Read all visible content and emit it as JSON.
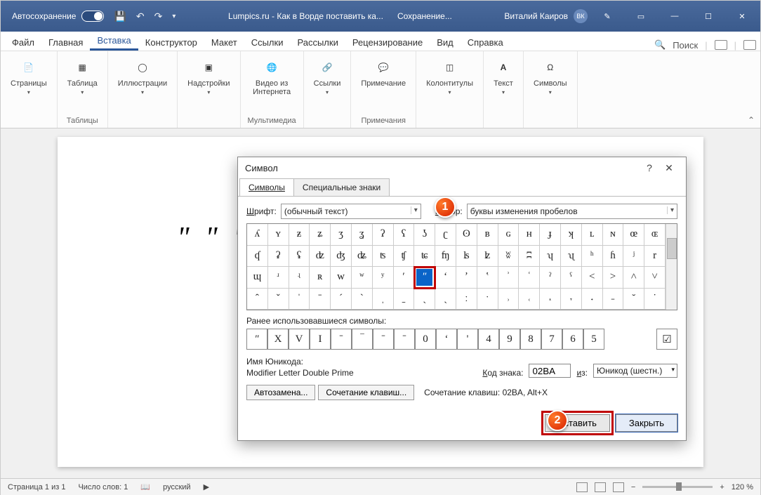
{
  "titlebar": {
    "autosave": "Автосохранение",
    "doc_title": "Lumpics.ru - Как в Ворде поставить ка...",
    "saving": "Сохранение...",
    "user_name": "Виталий Каиров",
    "user_initials": "ВК"
  },
  "tabs": [
    "Файл",
    "Главная",
    "Вставка",
    "Конструктор",
    "Макет",
    "Ссылки",
    "Рассылки",
    "Рецензирование",
    "Вид",
    "Справка"
  ],
  "active_tab": 2,
  "search_hint": "Поиск",
  "ribbon": {
    "groups": [
      {
        "items": [
          {
            "label": "Страницы",
            "chev": true
          }
        ],
        "name": ""
      },
      {
        "items": [
          {
            "label": "Таблица",
            "chev": true
          }
        ],
        "name": "Таблицы"
      },
      {
        "items": [
          {
            "label": "Иллюстрации",
            "chev": true
          }
        ],
        "name": ""
      },
      {
        "items": [
          {
            "label": "Надстройки",
            "chev": true
          }
        ],
        "name": ""
      },
      {
        "items": [
          {
            "label": "Видео из\nИнтернета"
          }
        ],
        "name": "Мультимедиа"
      },
      {
        "items": [
          {
            "label": "Ссылки",
            "chev": true
          }
        ],
        "name": ""
      },
      {
        "items": [
          {
            "label": "Примечание"
          }
        ],
        "name": "Примечания"
      },
      {
        "items": [
          {
            "label": "Колонтитулы",
            "chev": true
          }
        ],
        "name": ""
      },
      {
        "items": [
          {
            "label": "Текст",
            "chev": true
          }
        ],
        "name": ""
      },
      {
        "items": [
          {
            "label": "Символы",
            "chev": true
          }
        ],
        "name": ""
      }
    ]
  },
  "document_text": "ʺ ʺ ʺ ʺ",
  "dialog": {
    "title": "Символ",
    "tabs": [
      "Символы",
      "Специальные знаки"
    ],
    "font_label": "Шрифт:",
    "font_value": "(обычный текст)",
    "set_label": "Набор:",
    "set_value": "буквы изменения пробелов",
    "grid": [
      [
        "ʎ",
        "ʏ",
        "ƶ",
        "ʑ",
        "ʒ",
        "ʓ",
        "ʔ",
        "ʕ",
        "ʖ",
        "ʗ",
        "ʘ",
        "ʙ",
        "ɢ",
        "ʜ",
        "ɟ",
        "ʞ",
        "ʟ",
        "ɴ",
        "œ",
        "ɶ"
      ],
      [
        "ʠ",
        "ʡ",
        "ʢ",
        "ʣ",
        "ʤ",
        "ʥ",
        "ʦ",
        "ʧ",
        "ʨ",
        "ʩ",
        "ʪ",
        "ʫ",
        "ʬ",
        "ʭ",
        "ʮ",
        "ʯ",
        "ʰ",
        "ɦ",
        "ʲ",
        "r"
      ],
      [
        "ɰ",
        "ʴ",
        "ʵ",
        "ʀ",
        "w",
        "ʷ",
        "ʸ",
        "ʹ",
        "ʺ",
        "ʻ",
        "ʼ",
        "ʽ",
        "ʾ",
        "ʿ",
        "ˀ",
        "ˁ",
        "˂",
        "˃",
        "˄",
        "˅"
      ],
      [
        "ˆ",
        "ˇ",
        "ˈ",
        "ˉ",
        "ˊ",
        "ˋ",
        "ˌ",
        "ˍ",
        "ˎ",
        "ˏ",
        "ː",
        "ˑ",
        "˒",
        "˓",
        "˔",
        "˕",
        "˖",
        "˗",
        "˘",
        "˙"
      ]
    ],
    "selected": {
      "row": 2,
      "col": 8
    },
    "recent_label": "Ранее использовавшиеся символы:",
    "recent": [
      "ʺ",
      "X",
      "V",
      "I",
      "ˉ",
      "‾",
      "ˉ",
      "ˉ",
      "0",
      "ʻ",
      "'",
      "4",
      "9",
      "8",
      "7",
      "6",
      "5"
    ],
    "recent_last": "☑",
    "unicode_label": "Имя Юникода:",
    "unicode_name": "Modifier Letter Double Prime",
    "code_label": "Код знака:",
    "code_value": "02BA",
    "from_label": "из:",
    "from_value": "Юникод (шестн.)",
    "autocorrect_btn": "Автозамена...",
    "shortcut_btn": "Сочетание клавиш...",
    "shortcut_label": "Сочетание клавиш: 02BA, Alt+X",
    "insert_btn": "Вставить",
    "close_btn": "Закрыть"
  },
  "callouts": {
    "1": "1",
    "2": "2"
  },
  "status": {
    "page": "Страница 1 из 1",
    "words": "Число слов: 1",
    "lang": "русский",
    "zoom": "120 %"
  }
}
